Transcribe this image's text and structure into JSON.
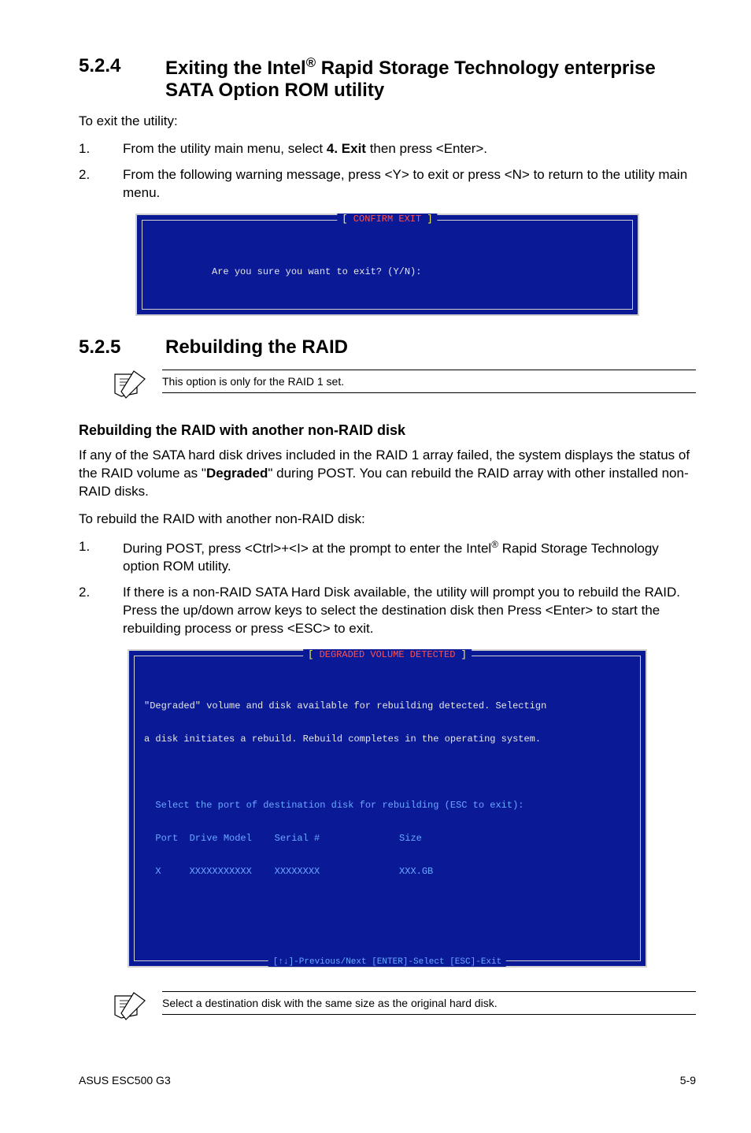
{
  "section_524": {
    "num": "5.2.4",
    "title_pre": "Exiting the Intel",
    "title_sup": "®",
    "title_post": " Rapid Storage Technology enterprise SATA Option ROM utility",
    "intro": "To exit the utility:",
    "steps": [
      {
        "n": "1.",
        "t_pre": "From the utility main menu, select ",
        "t_bold": "4. Exit",
        "t_post": " then press <Enter>."
      },
      {
        "n": "2.",
        "t": "From the following warning message, press <Y> to exit or press <N> to return to the utility main menu."
      }
    ],
    "console": {
      "label": "CONFIRM EXIT",
      "body": "          Are you sure you want to exit? (Y/N):"
    }
  },
  "section_525": {
    "num": "5.2.5",
    "title": "Rebuilding the RAID",
    "note1": "This option is only for the RAID 1 set.",
    "sub": "Rebuilding the RAID with another non-RAID disk",
    "para1_pre": "If any of the SATA hard disk drives included in the RAID 1 array failed, the system displays the status of the RAID volume as \"",
    "para1_bold": "Degraded",
    "para1_post": "\" during POST. You can rebuild the RAID array with other installed non-RAID disks.",
    "para2": "To rebuild the RAID with another non-RAID disk:",
    "steps": [
      {
        "n": "1.",
        "t_pre": "During POST, press <Ctrl>+<I> at the prompt to enter the Intel",
        "t_sup": "®",
        "t_post": " Rapid Storage Technology option ROM utility."
      },
      {
        "n": "2.",
        "t": "If there is a non-RAID SATA Hard Disk available, the utility will prompt you to rebuild the RAID. Press the up/down arrow keys to select  the destination disk then Press <Enter> to start the rebuilding process or press <ESC> to exit."
      }
    ],
    "console": {
      "label": "DEGRADED VOLUME DETECTED",
      "line1": "\"Degraded\" volume and disk available for rebuilding detected. Selectign",
      "line2": "a disk initiates a rebuild. Rebuild completes in the operating system.",
      "line3": "  Select the port of destination disk for rebuilding (ESC to exit):",
      "line4": "  Port  Drive Model    Serial #              Size",
      "line5": "  X     XXXXXXXXXXX    XXXXXXXX              XXX.GB",
      "footer": "[↑↓]-Previous/Next [ENTER]-Select [ESC]-Exit"
    },
    "note2": "Select a destination disk with the same size as the original hard disk."
  },
  "footer": {
    "left": "ASUS ESC500 G3",
    "right": "5-9"
  }
}
